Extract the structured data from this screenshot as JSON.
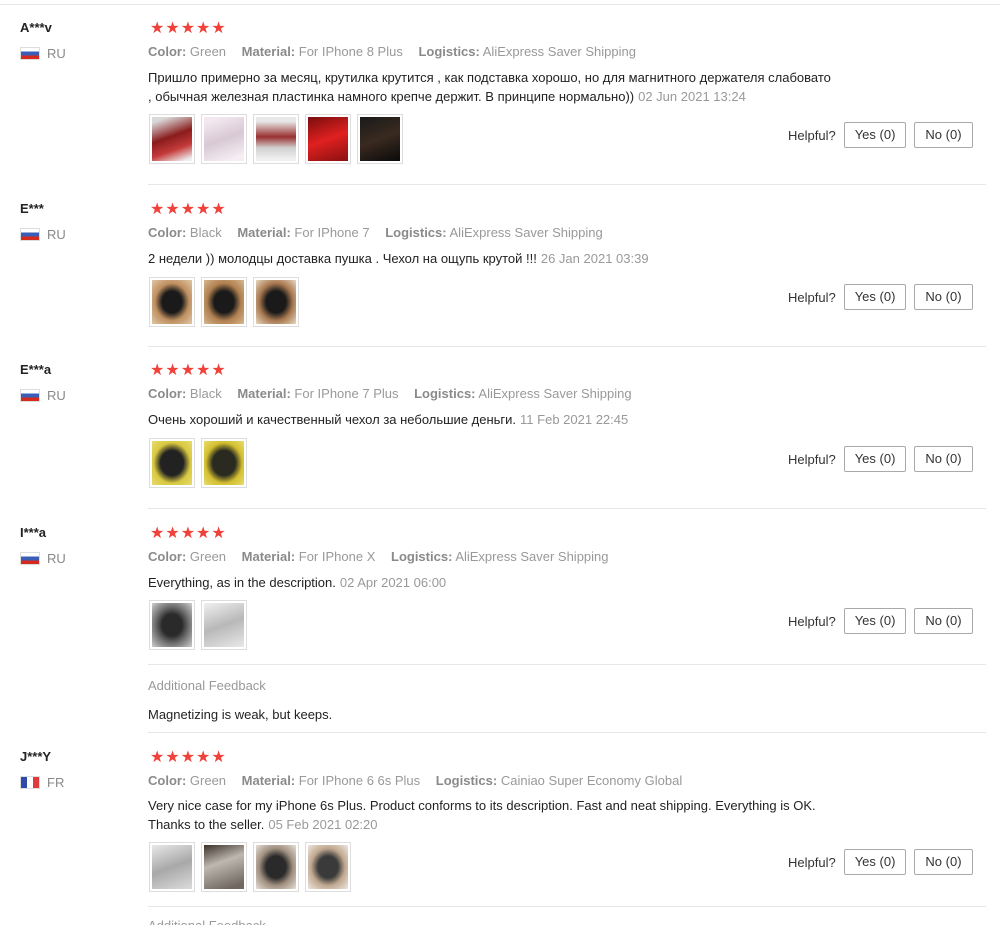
{
  "labels": {
    "color": "Color:",
    "material": "Material:",
    "logistics": "Logistics:",
    "helpful": "Helpful?",
    "yes": "Yes (0)",
    "no": "No (0)",
    "additional_feedback": "Additional Feedback"
  },
  "colors": {
    "star": "#f0413b",
    "accent_text": "#999999"
  },
  "reviews": [
    {
      "user": "A***v",
      "country": "RU",
      "flag": "ru-flag-icon",
      "rating": 5,
      "color": "Green",
      "material": "For IPhone 8 Plus",
      "logistics": "AliExpress Saver Shipping",
      "text_line1": "Пришло примерно за месяц, крутилка крутится , как подставка хорошо, но для магнитного держателя слабовато",
      "text_line2": ", обычная железная пластинка намного крепче держит. В принципе нормально))",
      "date": "02 Jun 2021 13:24",
      "thumb_count": 5
    },
    {
      "user": "E***",
      "country": "RU",
      "flag": "ru-flag-icon",
      "rating": 5,
      "color": "Black",
      "material": "For IPhone 7",
      "logistics": "AliExpress Saver Shipping",
      "text_line1": "2 недели )) молодцы доставка пушка . Чехол на ощупь крутой !!!",
      "date": "26 Jan 2021 03:39",
      "thumb_count": 3
    },
    {
      "user": "E***a",
      "country": "RU",
      "flag": "ru-flag-icon",
      "rating": 5,
      "color": "Black",
      "material": "For IPhone 7 Plus",
      "logistics": "AliExpress Saver Shipping",
      "text_line1": "Очень хороший и качественный чехол за небольшие деньги.",
      "date": "11 Feb 2021 22:45",
      "thumb_count": 2
    },
    {
      "user": "I***a",
      "country": "RU",
      "flag": "ru-flag-icon",
      "rating": 5,
      "color": "Green",
      "material": "For IPhone X",
      "logistics": "AliExpress Saver Shipping",
      "text_line1": "Everything, as in the description.",
      "date": "02 Apr 2021 06:00",
      "thumb_count": 2,
      "additional_feedback": "Magnetizing is weak, but keeps."
    },
    {
      "user": "J***Y",
      "country": "FR",
      "flag": "fr-flag-icon",
      "rating": 5,
      "color": "Green",
      "material": "For IPhone 6 6s Plus",
      "logistics": "Cainiao Super Economy Global",
      "text_line1": "Very nice case for my iPhone 6s Plus. Product conforms to its description. Fast and neat shipping. Everything is OK.",
      "text_line2": "Thanks to the seller.",
      "date": "05 Feb 2021 02:20",
      "thumb_count": 4
    }
  ]
}
